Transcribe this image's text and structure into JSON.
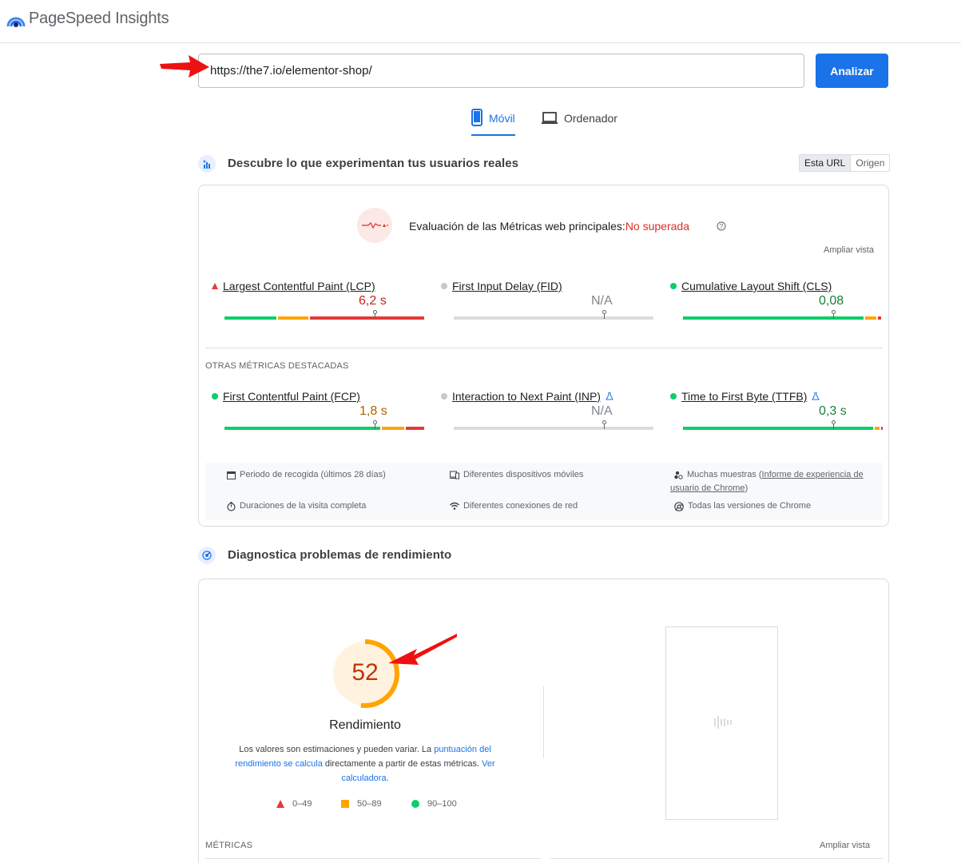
{
  "app": {
    "title": "PageSpeed Insights"
  },
  "url_bar": {
    "value": "https://the7.io/elementor-shop/",
    "analyze_label": "Analizar"
  },
  "device_tabs": [
    {
      "label": "Móvil",
      "active": true,
      "icon": "phone-icon"
    },
    {
      "label": "Ordenador",
      "active": false,
      "icon": "laptop-icon"
    }
  ],
  "field_data": {
    "section_title": "Descubre lo que experimentan tus usuarios reales",
    "scope_toggle": [
      "Esta URL",
      "Origen"
    ],
    "assessment_label": "Evaluación de las Métricas web principales:",
    "assessment_status": "No superada",
    "expand_label": "Ampliar vista",
    "core_metrics": [
      {
        "name": "Largest Contentful Paint (LCP)",
        "value": "6,2 s",
        "status": "poor",
        "pos": 0.75
      },
      {
        "name": "First Input Delay (FID)",
        "value": "N/A",
        "status": "none",
        "pos": 0.75
      },
      {
        "name": "Cumulative Layout Shift (CLS)",
        "value": "0,08",
        "status": "good",
        "pos": 0.75
      }
    ],
    "other_label": "OTRAS MÉTRICAS DESTACADAS",
    "other_metrics": [
      {
        "name": "First Contentful Paint (FCP)",
        "value": "1,8 s",
        "status": "good",
        "pos": 0.75
      },
      {
        "name": "Interaction to Next Paint (INP)",
        "value": "N/A",
        "status": "none",
        "pos": 0.75,
        "experimental": true
      },
      {
        "name": "Time to First Byte (TTFB)",
        "value": "0,3 s",
        "status": "good",
        "pos": 0.75,
        "experimental": true
      }
    ],
    "info": {
      "period": "Periodo de recogida (últimos 28 días)",
      "devices": "Diferentes dispositivos móviles",
      "samples_prefix": "Muchas muestras (",
      "samples_link_1": "Informe de experiencia de",
      "samples_link_2": "usuario de Chrome",
      "samples_suffix": ")",
      "durations": "Duraciones de la visita completa",
      "connections": "Diferentes conexiones de red",
      "versions": "Todas las versiones de Chrome"
    }
  },
  "lab_data": {
    "section_title": "Diagnostica problemas de rendimiento",
    "score": "52",
    "score_fraction": 0.52,
    "score_label": "Rendimiento",
    "desc_1": "Los valores son estimaciones y pueden variar. La ",
    "desc_link_1": "puntuación del rendimiento se calcula",
    "desc_2": " directamente a partir de estas métricas. ",
    "desc_link_2": "Ver calculadora",
    "desc_3": ".",
    "legend": [
      "0–49",
      "50–89",
      "90–100"
    ],
    "metrics_label": "MÉTRICAS",
    "expand_label": "Ampliar vista"
  },
  "colors": {
    "accent": "#1a73e8",
    "poor": "#e53935",
    "average": "#ffa400",
    "good": "#0cce6b",
    "poor_text": "#c5221f",
    "average_text": "#b06000",
    "good_text": "#188038",
    "na_text": "#80868b"
  }
}
